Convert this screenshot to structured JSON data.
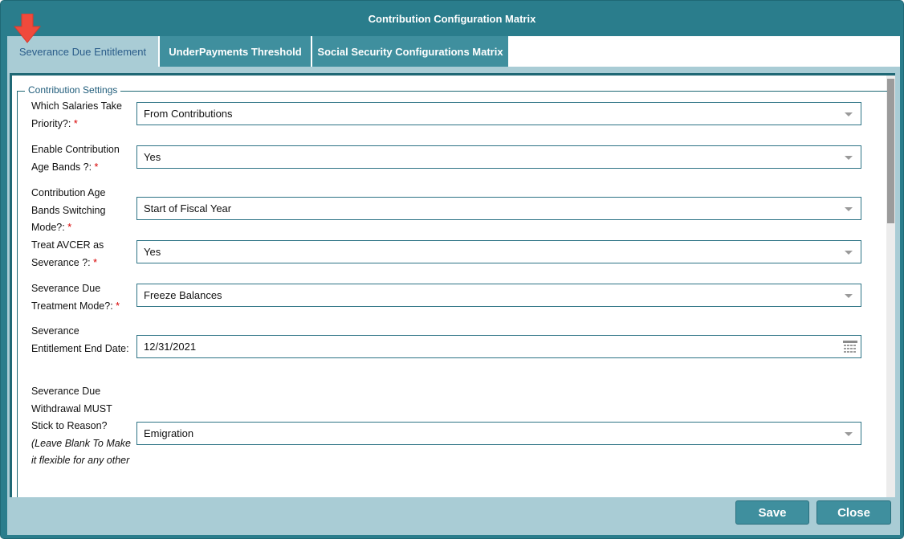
{
  "dialog": {
    "title": "Contribution Configuration Matrix"
  },
  "tabs": [
    {
      "label": "Severance Due Entitlement",
      "active": true
    },
    {
      "label": "UnderPayments Threshold",
      "active": false
    },
    {
      "label": "Social Security Configurations Matrix",
      "active": false
    }
  ],
  "section": {
    "legend": "Contribution Settings"
  },
  "fields": {
    "salaries_priority": {
      "label": "Which Salaries Take Priority?:",
      "value": "From Contributions"
    },
    "age_bands": {
      "label": "Enable Contribution Age Bands ?:",
      "value": "Yes"
    },
    "switching_mode": {
      "label": "Contribution Age Bands Switching Mode?:",
      "value": "Start of Fiscal Year"
    },
    "avcer": {
      "label": "Treat AVCER as Severance ?:",
      "value": "Yes"
    },
    "treatment_mode": {
      "label": "Severance Due Treatment Mode?:",
      "value": "Freeze Balances"
    },
    "end_date": {
      "label": "Severance Entitlement End Date:",
      "value": "12/31/2021"
    },
    "withdrawal_reason": {
      "label": "Severance Due Withdrawal MUST Stick to Reason?",
      "label_note": "(Leave Blank To Make it flexible for any other",
      "value": "Emigration"
    }
  },
  "required_marker": "*",
  "buttons": {
    "save": "Save",
    "close": "Close"
  },
  "colors": {
    "accent": "#2a7d8c",
    "required": "#d80000",
    "marker_arrow": "#f04a3c"
  },
  "icons": {
    "marker": "red-down-arrow",
    "dropdown": "chevron-down-icon",
    "calendar": "calendar-icon"
  }
}
